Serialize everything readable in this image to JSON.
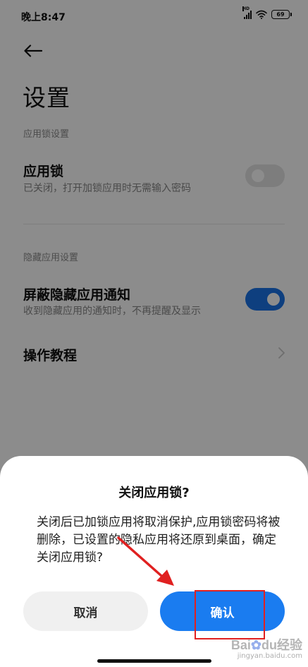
{
  "status_bar": {
    "time": "晚上8:47",
    "signal_label": "HD",
    "battery": "69"
  },
  "page": {
    "title": "设置",
    "sections": [
      {
        "label": "应用锁设置",
        "item_title": "应用锁",
        "item_subtitle": "已关闭，打开加锁应用时无需输入密码",
        "switch_on": false
      },
      {
        "label": "隐藏应用设置",
        "item_title": "屏蔽隐藏应用通知",
        "item_subtitle": "收到隐藏应用的通知时，不再提醒及显示",
        "switch_on": true
      }
    ],
    "tutorial": "操作教程"
  },
  "dialog": {
    "title": "关闭应用锁?",
    "message": "关闭后已加锁应用将取消保护,应用锁密码将被删除，已设置的隐私应用将还原到桌面，确定关闭应用锁?",
    "cancel_label": "取消",
    "confirm_label": "确认"
  },
  "watermark": {
    "logo_a": "Bai",
    "logo_b": "du",
    "logo_c": "经验",
    "url": "jingyan.baidu.com"
  },
  "colors": {
    "accent": "#1a7cf0",
    "annotation": "#e02020"
  }
}
